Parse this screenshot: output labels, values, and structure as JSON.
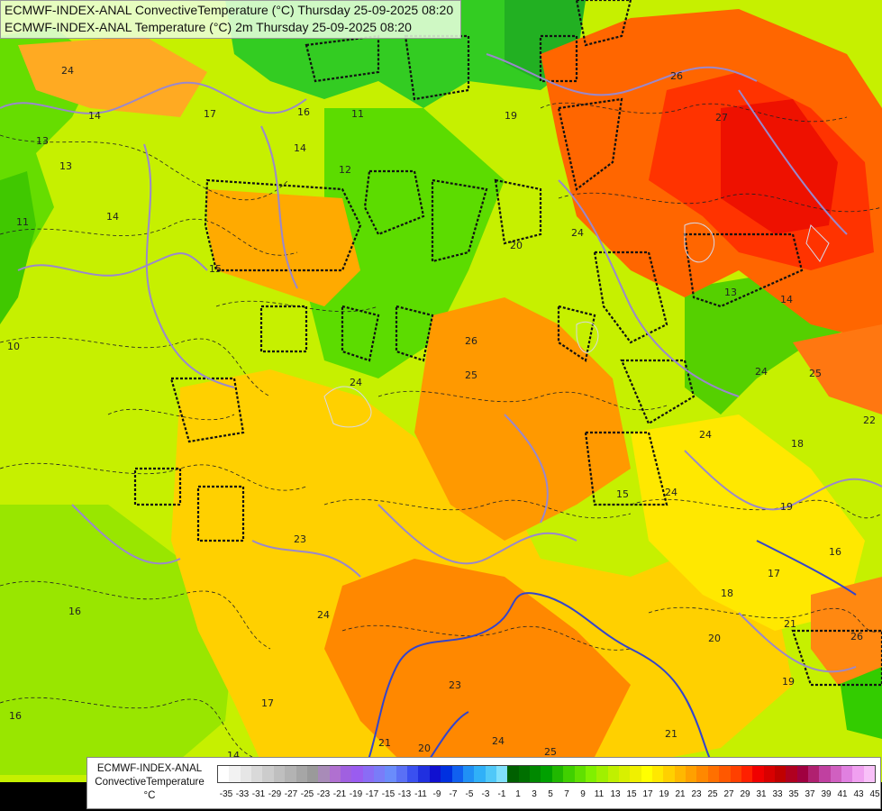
{
  "header": {
    "line1": "ECMWF-INDEX-ANAL ConvectiveTemperature (°C) Thursday 25-09-2025 08:20",
    "line2": "ECMWF-INDEX-ANAL Temperature (°C) 2m Thursday 25-09-2025 08:20"
  },
  "legend": {
    "title_line1": "ECMWF-INDEX-ANAL",
    "title_line2": "ConvectiveTemperature",
    "unit": "°C",
    "ticks": [
      "-35",
      "-33",
      "-31",
      "-29",
      "-27",
      "-25",
      "-23",
      "-21",
      "-19",
      "-17",
      "-15",
      "-13",
      "-11",
      "-9",
      "-7",
      "-5",
      "-3",
      "-1",
      "1",
      "3",
      "5",
      "7",
      "9",
      "11",
      "13",
      "15",
      "17",
      "19",
      "21",
      "23",
      "25",
      "27",
      "29",
      "31",
      "33",
      "35",
      "37",
      "39",
      "41",
      "43",
      "45"
    ],
    "colors": [
      "#ffffff",
      "#f2f2f2",
      "#e6e6e6",
      "#d9d9d9",
      "#cccccc",
      "#bfbfbf",
      "#b3b3b3",
      "#a6a6a6",
      "#9a9a9a",
      "#a88bb8",
      "#b070d0",
      "#a060e0",
      "#9a5cf0",
      "#8a6cf5",
      "#7a7cf8",
      "#6a8cfb",
      "#5a70f5",
      "#3a50f0",
      "#2030e0",
      "#1010d0",
      "#0030e0",
      "#1060f0",
      "#2090f5",
      "#30b0f8",
      "#50c8f8",
      "#80e0fc",
      "#006000",
      "#007000",
      "#008800",
      "#00a000",
      "#20b800",
      "#40d000",
      "#60e000",
      "#80f000",
      "#a0f000",
      "#c0f000",
      "#d8f000",
      "#f0f000",
      "#ffff00",
      "#ffe800",
      "#ffd000",
      "#ffb800",
      "#ffa000",
      "#ff8800",
      "#ff7000",
      "#ff5800",
      "#ff4000",
      "#ff2000",
      "#f00000",
      "#d80000",
      "#c00000",
      "#b00020",
      "#a00040",
      "#b02070",
      "#c040a0",
      "#d060c0",
      "#e080e0",
      "#f0a0f0",
      "#f8c0f8"
    ]
  },
  "contour_labels": [
    "24",
    "14",
    "13",
    "11",
    "10",
    "14",
    "13",
    "12",
    "11",
    "16",
    "17",
    "15",
    "14",
    "19",
    "26",
    "27",
    "24",
    "20",
    "24",
    "26",
    "25",
    "23",
    "24",
    "24",
    "13",
    "14",
    "25",
    "24",
    "22",
    "18",
    "19",
    "17",
    "16",
    "18",
    "21",
    "26",
    "20",
    "19",
    "21",
    "25",
    "24",
    "23",
    "21",
    "20",
    "24",
    "16",
    "17",
    "16",
    "14",
    "15"
  ]
}
